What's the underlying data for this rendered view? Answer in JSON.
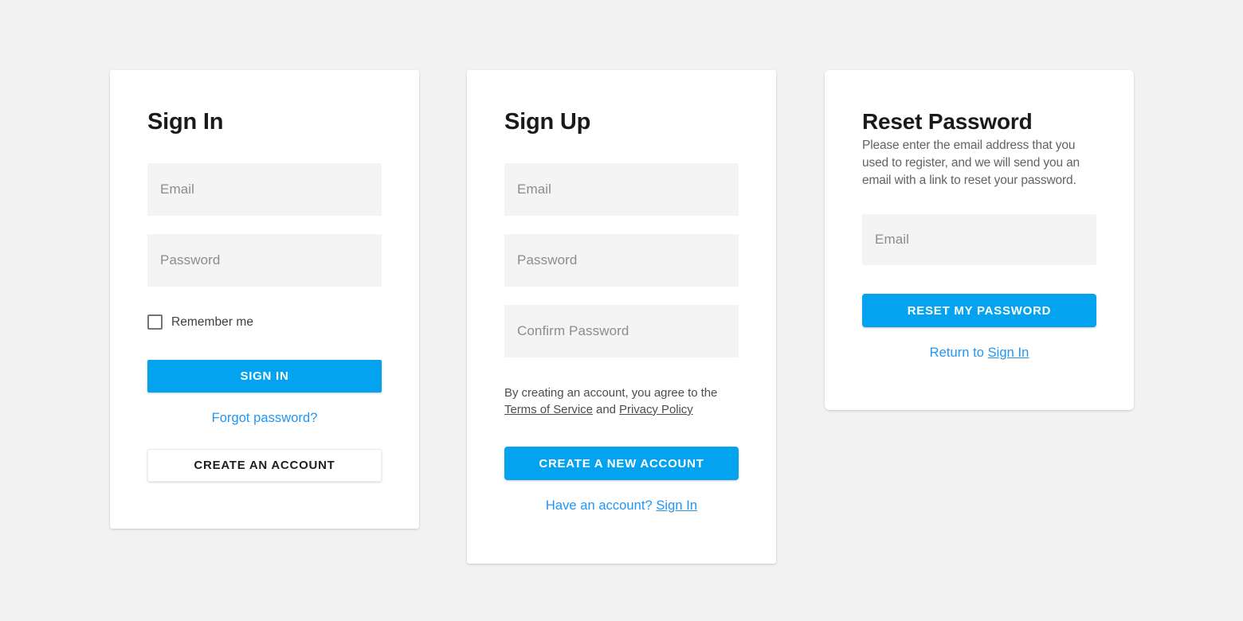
{
  "theme": {
    "page_background": "#f2f2f3",
    "card_background": "#ffffff",
    "accent": "#03a3f0",
    "link_color": "#2196f3",
    "input_background": "#f4f4f5",
    "placeholder_color": "#8a8d91",
    "heading_color": "#1a1a1a",
    "body_text_color": "#5f6368"
  },
  "sign_in": {
    "title": "Sign In",
    "email_placeholder": "Email",
    "email_value": "",
    "password_placeholder": "Password",
    "password_value": "",
    "remember_label": "Remember me",
    "remember_checked": false,
    "submit_label": "SIGN IN",
    "forgot_label": "Forgot password?",
    "create_account_label": "CREATE AN ACCOUNT"
  },
  "sign_up": {
    "title": "Sign Up",
    "email_placeholder": "Email",
    "email_value": "",
    "password_placeholder": "Password",
    "password_value": "",
    "confirm_password_placeholder": "Confirm Password",
    "confirm_password_value": "",
    "legal_prefix": "By creating an account, you agree to the",
    "terms_label": "Terms of Service",
    "legal_conjunction": "and",
    "privacy_label": "Privacy Policy",
    "submit_label": "CREATE A NEW ACCOUNT",
    "have_account_prefix": "Have an account?",
    "sign_in_label": "Sign In"
  },
  "reset_password": {
    "title": "Reset Password",
    "description": "Please enter the email address that you used to register, and we will send you an email with a link to reset your password.",
    "email_placeholder": "Email",
    "email_value": "",
    "submit_label": "RESET MY PASSWORD",
    "return_prefix": "Return to",
    "sign_in_label": "Sign In"
  }
}
